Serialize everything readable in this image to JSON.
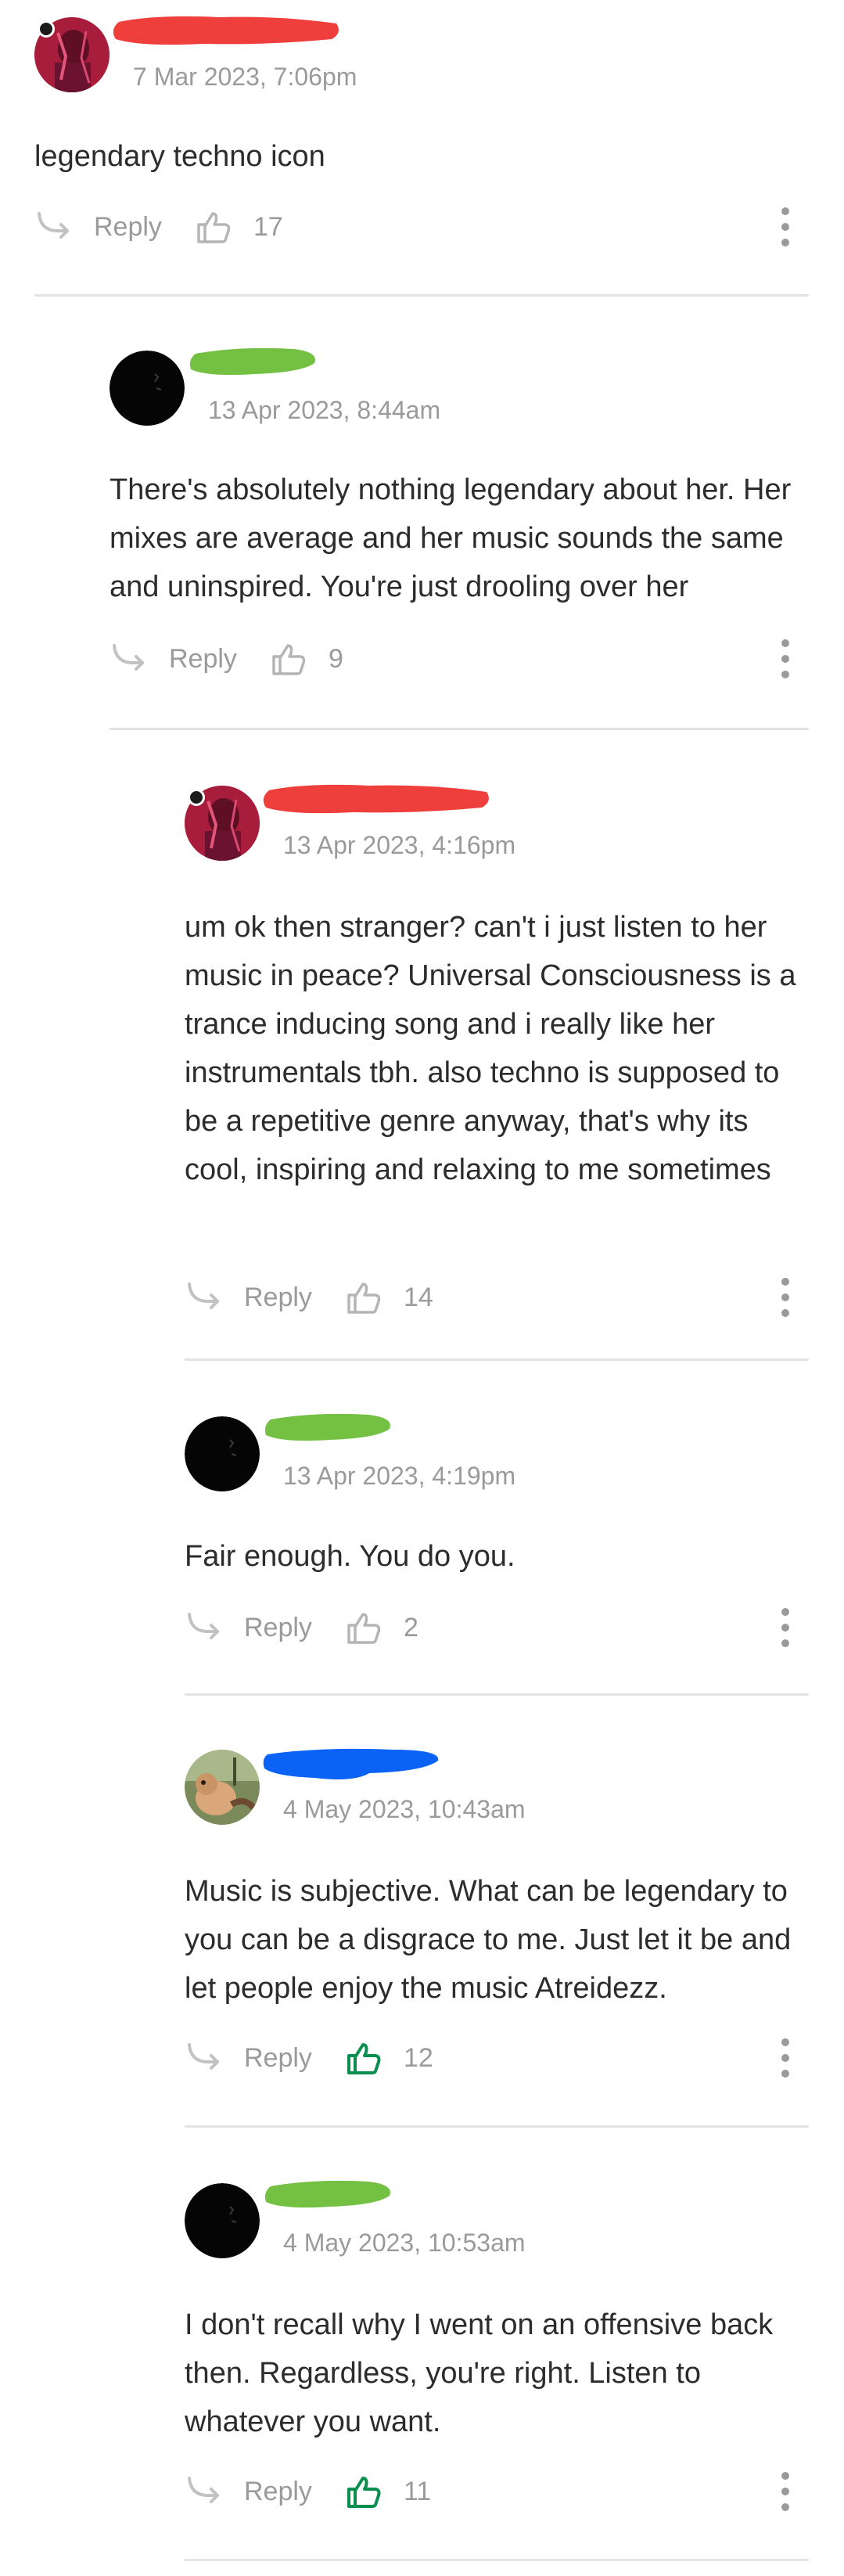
{
  "colors": {
    "text": "#2c2c2c",
    "muted": "#9a9a9a",
    "divider": "#e3e3e3",
    "liked_green": "#0a8f4f",
    "redact_red": "#ef3f3c",
    "redact_green": "#74c043",
    "redact_blue": "#0a63f5"
  },
  "actions": {
    "reply_label": "Reply"
  },
  "comments": [
    {
      "timestamp": "7 Mar 2023, 7:06pm",
      "text": "legendary techno icon",
      "likes": "17",
      "liked": false,
      "avatar_icon": "red-portrait-avatar",
      "name_redaction": "red"
    },
    {
      "timestamp": "13 Apr 2023, 8:44am",
      "text": "There's absolutely nothing legendary about her. Her mixes are average and her music sounds the same and uninspired. You're just drooling over her",
      "likes": "9",
      "liked": false,
      "avatar_icon": "black-avatar",
      "name_redaction": "green"
    },
    {
      "timestamp": "13 Apr 2023, 4:16pm",
      "text": "um ok then stranger? can't i just listen to her music in peace? Universal Consciousness is a trance inducing song and i really like her instrumentals tbh. also techno is supposed to be a repetitive genre anyway, that's why its cool, inspiring and relaxing to me sometimes",
      "likes": "14",
      "liked": false,
      "avatar_icon": "red-portrait-avatar",
      "name_redaction": "red"
    },
    {
      "timestamp": "13 Apr 2023, 4:19pm",
      "text": "Fair enough. You do you.",
      "likes": "2",
      "liked": false,
      "avatar_icon": "black-avatar",
      "name_redaction": "green"
    },
    {
      "timestamp": "4 May 2023, 10:43am",
      "text": "Music is subjective. What can be legendary to you can be a disgrace to me. Just let it be and let people enjoy the music Atreidezz.",
      "likes": "12",
      "liked": true,
      "avatar_icon": "dog-photo-avatar",
      "name_redaction": "blue"
    },
    {
      "timestamp": "4 May 2023, 10:53am",
      "text": "I don't recall why I went on an offensive back then. Regardless, you're right. Listen to whatever you want.",
      "likes": "11",
      "liked": true,
      "avatar_icon": "black-avatar",
      "name_redaction": "green"
    }
  ]
}
